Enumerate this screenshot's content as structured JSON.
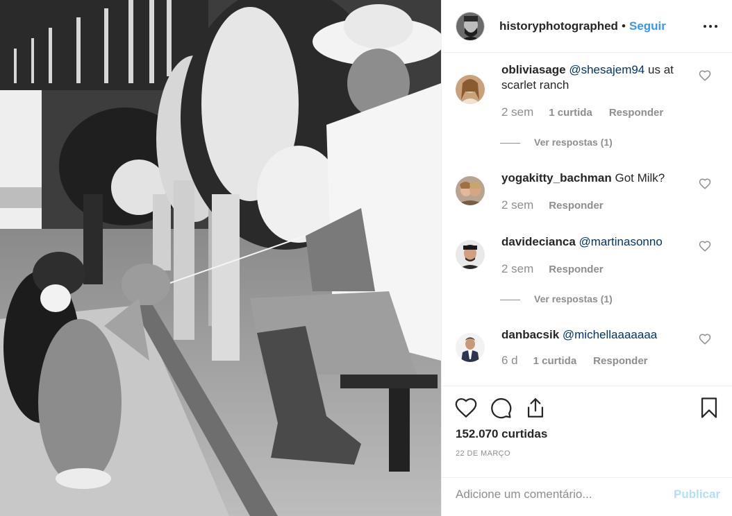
{
  "header": {
    "username": "historyphotographed",
    "separator": "•",
    "follow_label": "Seguir"
  },
  "comments": [
    {
      "user": "obliviasage",
      "mention": "@shesajem94",
      "text": "us at scarlet ranch",
      "time": "2 sem",
      "likes": "1 curtida",
      "reply": "Responder",
      "view_replies": "Ver respostas (1)"
    },
    {
      "user": "yogakitty_bachman",
      "mention": "",
      "text": "Got Milk?",
      "time": "2 sem",
      "reply": "Responder"
    },
    {
      "user": "davidecianca",
      "mention": "@martinasonno",
      "text": "",
      "time": "2 sem",
      "reply": "Responder",
      "view_replies": "Ver respostas (1)"
    },
    {
      "user": "danbacsik",
      "mention": "@michellaaaaaaa",
      "text": "",
      "time": "6 d",
      "likes": "1 curtida",
      "reply": "Responder"
    }
  ],
  "actions": {
    "likes_count": "152.070 curtidas",
    "date": "22 DE MARÇO",
    "icons": [
      "heart-icon",
      "comment-icon",
      "share-icon",
      "bookmark-icon"
    ]
  },
  "add_comment": {
    "placeholder": "Adicione um comentário...",
    "publish_label": "Publicar"
  },
  "colors": {
    "link_blue": "#3897f0",
    "mention": "#003569",
    "muted": "#8e8e8e",
    "publish_disabled": "#b2dffc"
  }
}
